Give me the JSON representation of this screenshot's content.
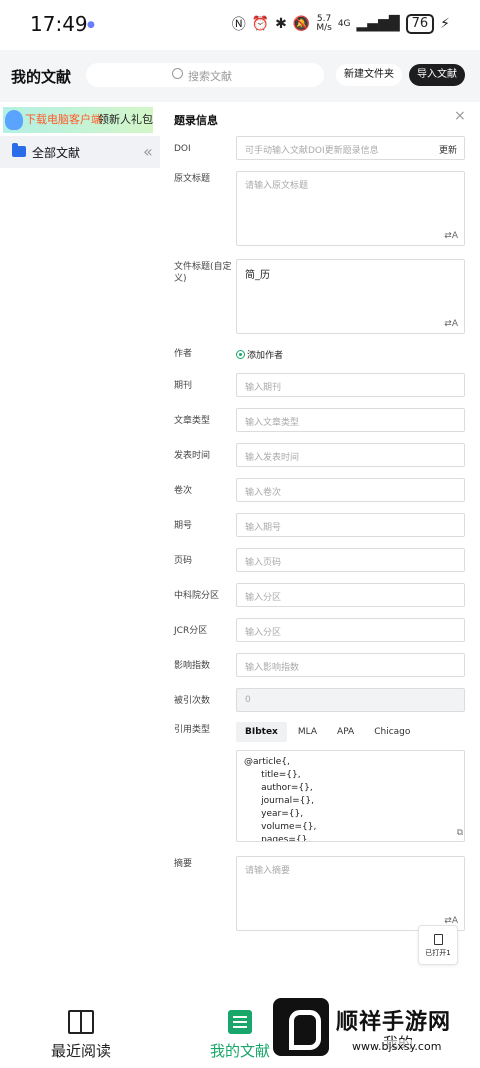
{
  "status_bar": {
    "time": "17:49",
    "net_speed": "5.7\nM/s",
    "network": "4G",
    "battery": "76"
  },
  "header": {
    "title": "我的文献",
    "search_placeholder": "搜索文献",
    "new_folder": "新建文件夹",
    "import": "导入文献"
  },
  "sidebar": {
    "promo_highlight": "下载电脑客户端",
    "promo_rest": "领新人礼包",
    "all_docs": "全部文献"
  },
  "panel": {
    "title": "题录信息",
    "doi": {
      "label": "DOI",
      "placeholder": "可手动输入文献DOI更新题录信息",
      "action": "更新"
    },
    "orig_title": {
      "label": "原文标题",
      "placeholder": "请输入原文标题"
    },
    "file_title": {
      "label": "文件标题(自定义)",
      "value": "简_历"
    },
    "author": {
      "label": "作者",
      "action": "添加作者"
    },
    "fields": [
      {
        "label": "期刊",
        "placeholder": "输入期刊"
      },
      {
        "label": "文章类型",
        "placeholder": "输入文章类型"
      },
      {
        "label": "发表时间",
        "placeholder": "输入发表时间"
      },
      {
        "label": "卷次",
        "placeholder": "输入卷次"
      },
      {
        "label": "期号",
        "placeholder": "输入期号"
      },
      {
        "label": "页码",
        "placeholder": "输入页码"
      },
      {
        "label": "中科院分区",
        "placeholder": "输入分区"
      },
      {
        "label": "JCR分区",
        "placeholder": "输入分区"
      },
      {
        "label": "影响指数",
        "placeholder": "输入影响指数"
      },
      {
        "label": "被引次数",
        "placeholder": "0"
      }
    ],
    "citation": {
      "label": "引用类型",
      "tabs": [
        "BIbtex",
        "MLA",
        "APA",
        "Chicago"
      ],
      "active_tab": "BIbtex",
      "content": "@article{,\n      title={},\n      author={},\n      journal={},\n      year={},\n      volume={},\n      pages={},"
    },
    "abstract": {
      "label": "摘要",
      "placeholder": "请输入摘要"
    },
    "opened_label": "已打开1"
  },
  "bottom_nav": {
    "recent": "最近阅读",
    "library": "我的文献",
    "me": "我的"
  },
  "watermark": {
    "title": "顺祥手游网",
    "url": "www.bjsxsy.com"
  },
  "colors": {
    "accent": "#19a66a",
    "primary_dark": "#1d1d1f",
    "folder": "#2b6de8"
  }
}
